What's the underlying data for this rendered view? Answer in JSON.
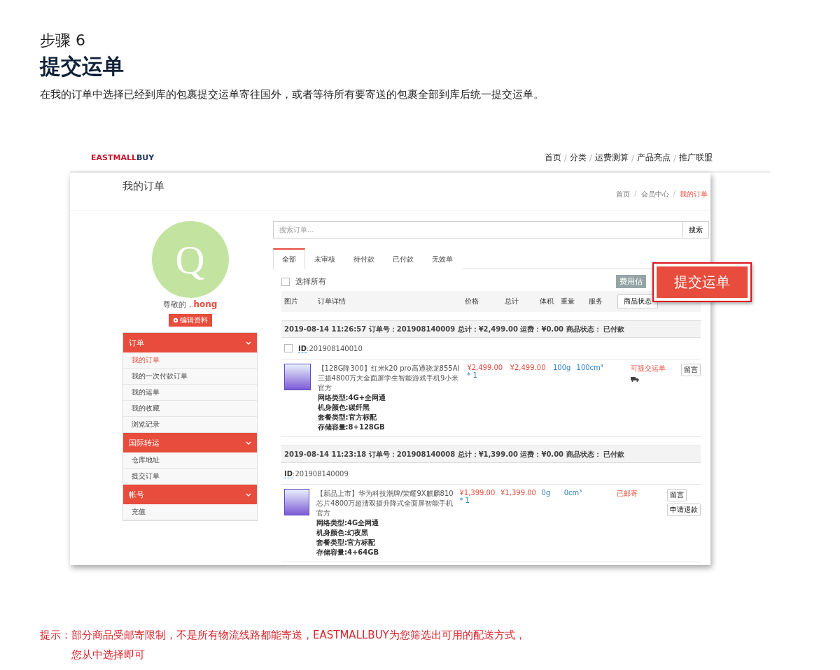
{
  "step_label": "步骤 6",
  "title": "提交运单",
  "description": "在我的订单中选择已经到库的包裹提交运单寄往国外，或者等待所有要寄送的包裹全部到库后统一提交运单。",
  "screenshot": {
    "brand": {
      "primary": "EASTMALL",
      "secondary": "BUY"
    },
    "nav": [
      "首页",
      "分类",
      "运费测算",
      "产品亮点",
      "推广联盟"
    ],
    "nav_separator": "/",
    "breadcrumb_separator": "/",
    "page_title": "我的订单",
    "breadcrumb": [
      {
        "label": "首页",
        "selected": false
      },
      {
        "label": "会员中心",
        "selected": false
      },
      {
        "label": "我的订单",
        "selected": true
      }
    ],
    "avatar_letter": "Q",
    "greeting": "尊敬的，",
    "username": "hong",
    "edit_button": "编辑资料",
    "menu": [
      {
        "title": "订单",
        "items": [
          {
            "label": "我的订单",
            "selected": true
          },
          {
            "label": "我的一次付款订单",
            "selected": false
          },
          {
            "label": "我的运单",
            "selected": false
          },
          {
            "label": "我的收藏",
            "selected": false
          },
          {
            "label": "浏览记录",
            "selected": false
          }
        ]
      },
      {
        "title": "国际转运",
        "items": [
          {
            "label": "仓库地址",
            "selected": false
          },
          {
            "label": "提交订单",
            "selected": false
          }
        ]
      },
      {
        "title": "帐号",
        "items": [
          {
            "label": "充值",
            "selected": false
          }
        ]
      }
    ],
    "search": {
      "placeholder": "搜索订单...",
      "button": "搜索"
    },
    "tabs": [
      {
        "label": "全部",
        "selected": true
      },
      {
        "label": "未审核",
        "selected": false
      },
      {
        "label": "待付款",
        "selected": false
      },
      {
        "label": "已付款",
        "selected": false
      },
      {
        "label": "无效单",
        "selected": false
      }
    ],
    "select_all": {
      "label": "选择所有",
      "checked": false
    },
    "estimate_button": "费用估",
    "columns": [
      "图片",
      "订单详情",
      "价格",
      "总计",
      "体积",
      "重量",
      "服务"
    ],
    "status_filter": "商品状态",
    "orders": [
      {
        "header": "2019-08-14 11:26:57 订单号：201908140009 总计：¥2,499.00 运费：¥0.00 商品状态： 已付款",
        "checkbox": {
          "checked": false
        },
        "id_label": "ID",
        "id": ":201908140010",
        "product": {
          "title": "【128G降300】红米k20 pro高通骁龙855AI三摄4800万大全面屏学生智能游戏手机9小米官方",
          "price": "¥2,499.00",
          "qty": "* 1",
          "total": "¥2,499.00",
          "weight": "100g",
          "volume": "100cm³",
          "specs": [
            "网络类型:4G+全网通",
            "机身颜色:碳纤黑",
            "套餐类型:官方标配",
            "存储容量:8+128GB"
          ],
          "status": "可提交运单",
          "shipping_icon": true,
          "actions": [
            "留言"
          ]
        }
      },
      {
        "header": "2019-08-14 11:23:18 订单号：201908140008 总计：¥1,399.00 运费：¥0.00 商品状态： 已付款",
        "id_label": "ID",
        "id": ":201908140009",
        "product": {
          "title": "【新品上市】华为科技潮牌/荣耀9X麒麟810芯片4800万超清双摄升降式全面屏智能手机官方",
          "price": "¥1,399.00",
          "qty": "* 1",
          "total": "¥1,399.00",
          "weight": "0g",
          "volume": "0cm³",
          "specs": [
            "网络类型:4G全网通",
            "机身颜色:幻夜黑",
            "套餐类型:官方标配",
            "存储容量:4+64GB"
          ],
          "status": "已邮寄",
          "shipping_icon": false,
          "actions": [
            "留言",
            "申请退款"
          ]
        }
      }
    ]
  },
  "callout": "提交运单",
  "hint": {
    "label": "提示：",
    "lines": [
      "部分商品受邮寄限制，不是所有物流线路都能寄送，EASTMALLBUY为您筛选出可用的配送方式，",
      "您从中选择即可"
    ]
  }
}
